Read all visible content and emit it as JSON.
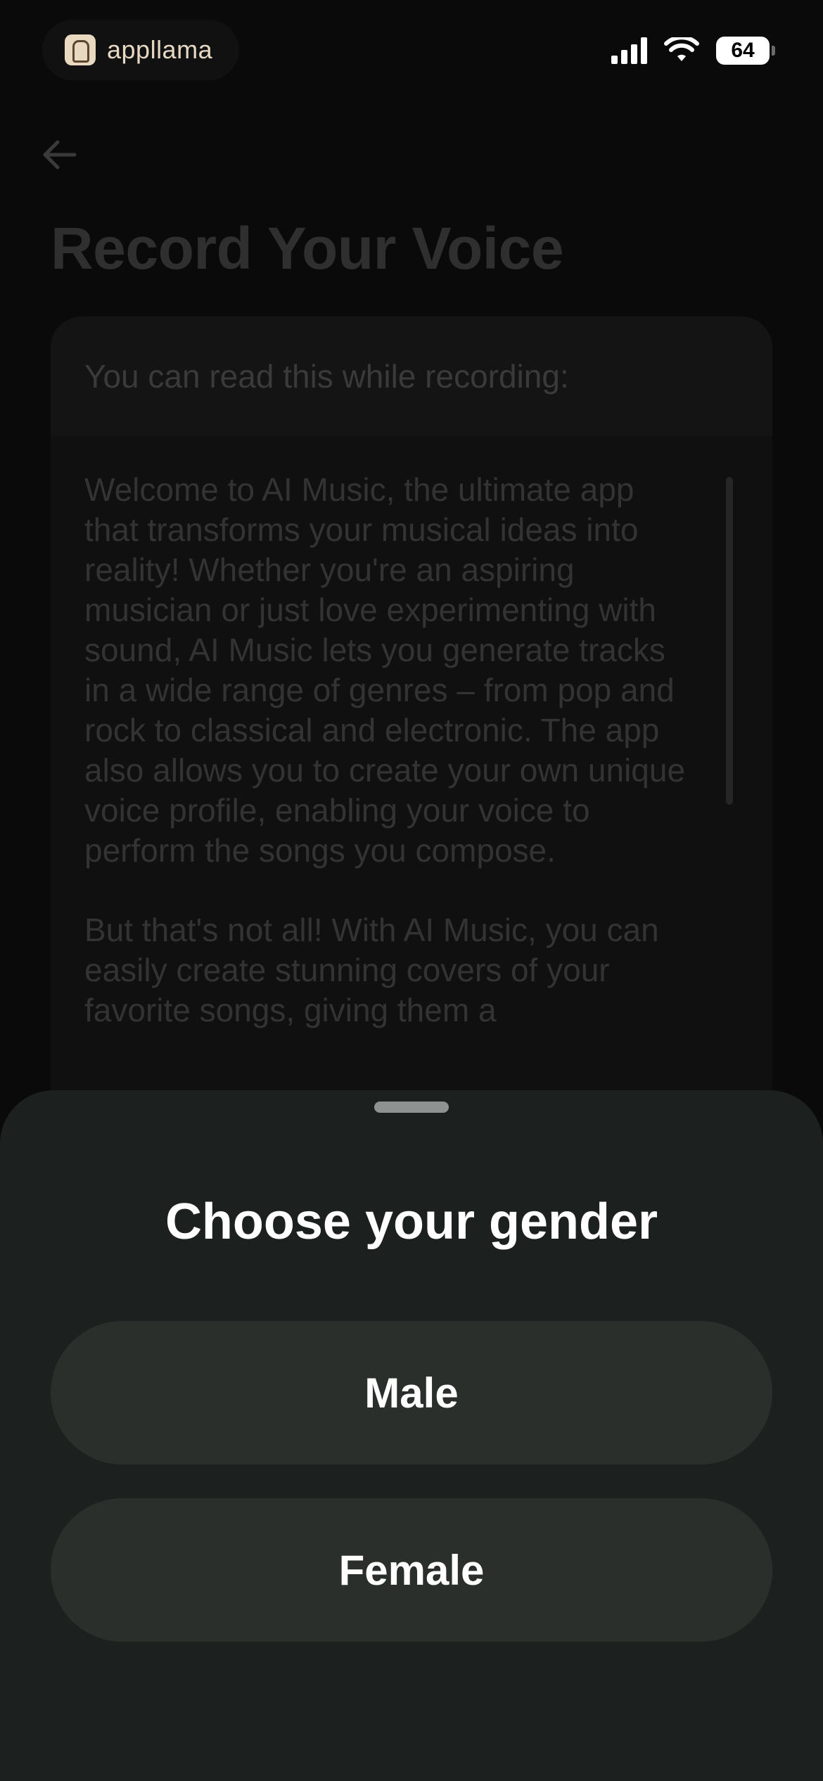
{
  "status_bar": {
    "brand_name": "appllama",
    "battery_level": "64",
    "signal_bars": 4,
    "icons": [
      "signal-icon",
      "wifi-icon",
      "battery-icon"
    ]
  },
  "header": {
    "back_icon": "arrow-left-icon",
    "title": "Record Your Voice"
  },
  "read_card": {
    "heading": "You can read this while recording:",
    "paragraphs": [
      "Welcome to AI Music, the ultimate app that transforms your musical ideas into reality! Whether you're an aspiring musician or just love experimenting with sound, AI Music lets you generate tracks in a wide range of genres – from pop and rock to classical and electronic. The app also allows you to create your own unique voice profile, enabling your voice to perform the songs you compose.",
      "But that's not all! With AI Music, you can easily create stunning covers of your favorite songs, giving them a"
    ]
  },
  "sheet": {
    "title": "Choose your gender",
    "options": [
      {
        "label": "Male"
      },
      {
        "label": "Female"
      }
    ]
  },
  "colors": {
    "background": "#0a0a0a",
    "sheet_background": "#1c201e",
    "option_background": "#2a2f2c",
    "text_primary": "#ffffff",
    "dimmed_text": "#333333",
    "brand_text": "#e6d8c2"
  }
}
